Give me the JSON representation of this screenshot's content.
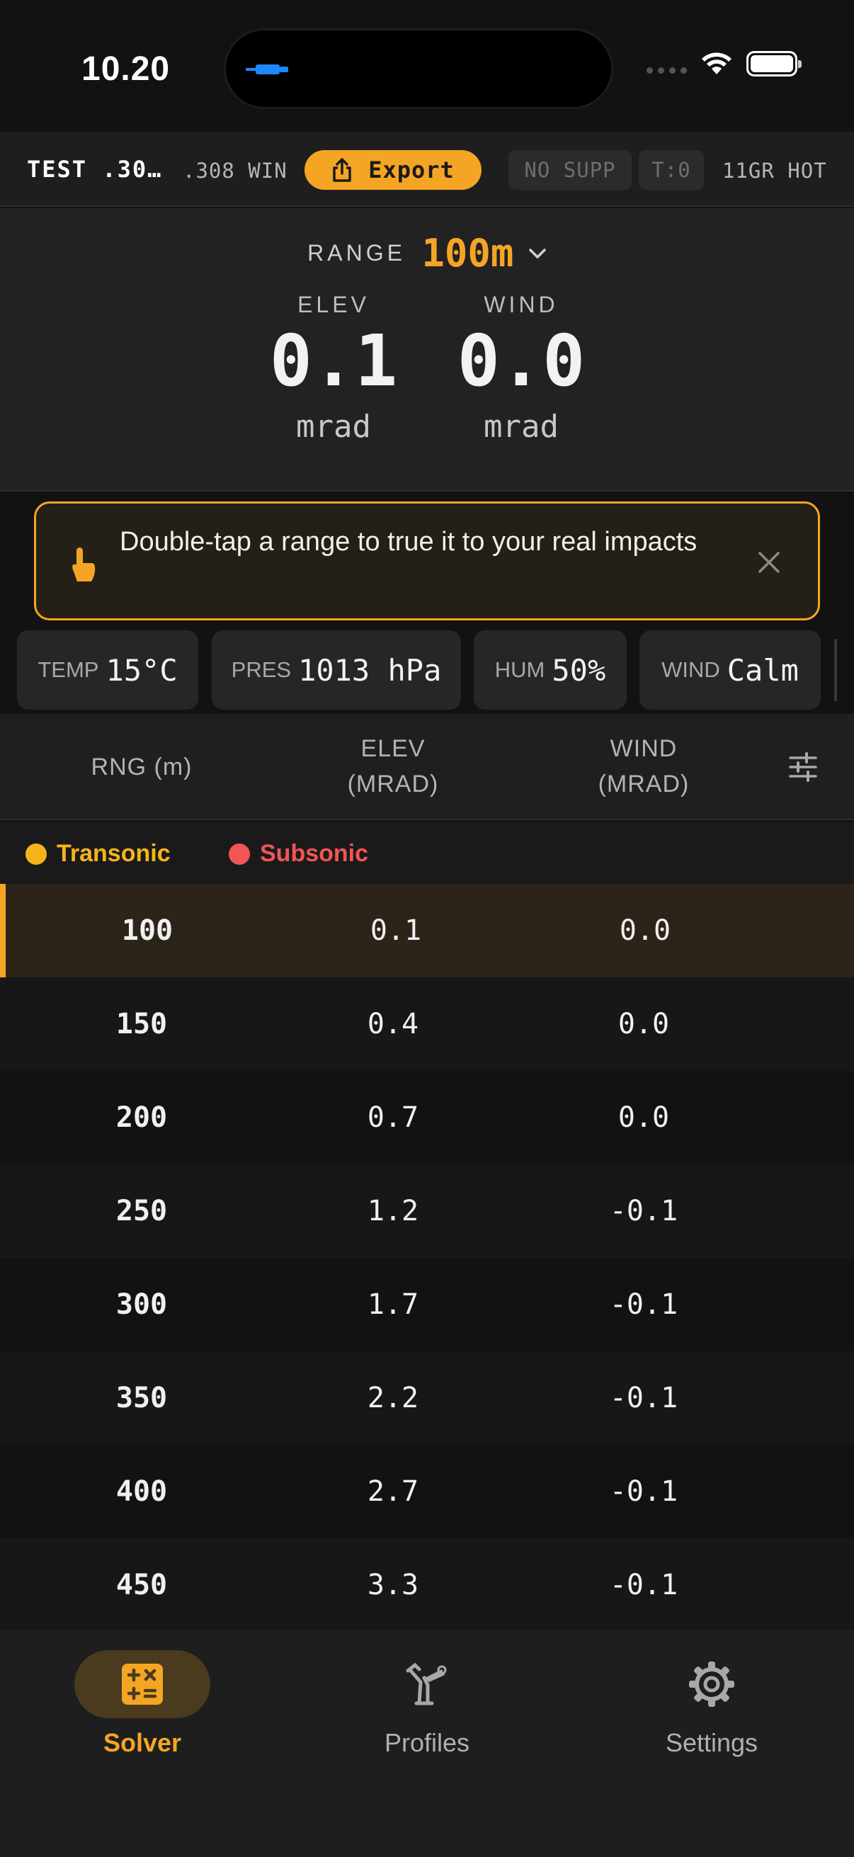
{
  "status_bar": {
    "time": "10.20"
  },
  "profile_bar": {
    "profile_name": "TEST .30…",
    "caliber": ".308 WIN",
    "export_label": "Export",
    "suppressor": "NO SUPP",
    "twist": "T:0",
    "ammo": "11GR HOT"
  },
  "solution": {
    "range_label": "RANGE",
    "range_value": "100m",
    "elev_label": "ELEV",
    "elev_value": "0.1",
    "elev_unit": "mrad",
    "wind_label": "WIND",
    "wind_value": "0.0",
    "wind_unit": "mrad"
  },
  "hint": {
    "text": "Double-tap a range to true it to your real impacts"
  },
  "conditions": [
    {
      "key": "TEMP",
      "value": "15°C"
    },
    {
      "key": "PRES",
      "value": "1013 hPa"
    },
    {
      "key": "HUM",
      "value": "50%"
    },
    {
      "key": "WIND",
      "value": "Calm"
    }
  ],
  "table": {
    "headers": {
      "range": "RNG (m)",
      "elev_1": "ELEV",
      "elev_2": "(MRAD)",
      "wind_1": "WIND",
      "wind_2": "(MRAD)"
    },
    "legend": {
      "transonic": "Transonic",
      "subsonic": "Subsonic"
    },
    "rows": [
      {
        "range": "100",
        "elev": "0.1",
        "wind": "0.0"
      },
      {
        "range": "150",
        "elev": "0.4",
        "wind": "0.0"
      },
      {
        "range": "200",
        "elev": "0.7",
        "wind": "0.0"
      },
      {
        "range": "250",
        "elev": "1.2",
        "wind": "-0.1"
      },
      {
        "range": "300",
        "elev": "1.7",
        "wind": "-0.1"
      },
      {
        "range": "350",
        "elev": "2.2",
        "wind": "-0.1"
      },
      {
        "range": "400",
        "elev": "2.7",
        "wind": "-0.1"
      },
      {
        "range": "450",
        "elev": "3.3",
        "wind": "-0.1"
      }
    ]
  },
  "tabs": [
    {
      "label": "Solver",
      "icon": "calculator-icon",
      "active": true
    },
    {
      "label": "Profiles",
      "icon": "profiles-icon",
      "active": false
    },
    {
      "label": "Settings",
      "icon": "gear-icon",
      "active": false
    }
  ],
  "colors": {
    "accent": "#f5a524",
    "transonic": "#f5b51a",
    "subsonic": "#f25555"
  }
}
